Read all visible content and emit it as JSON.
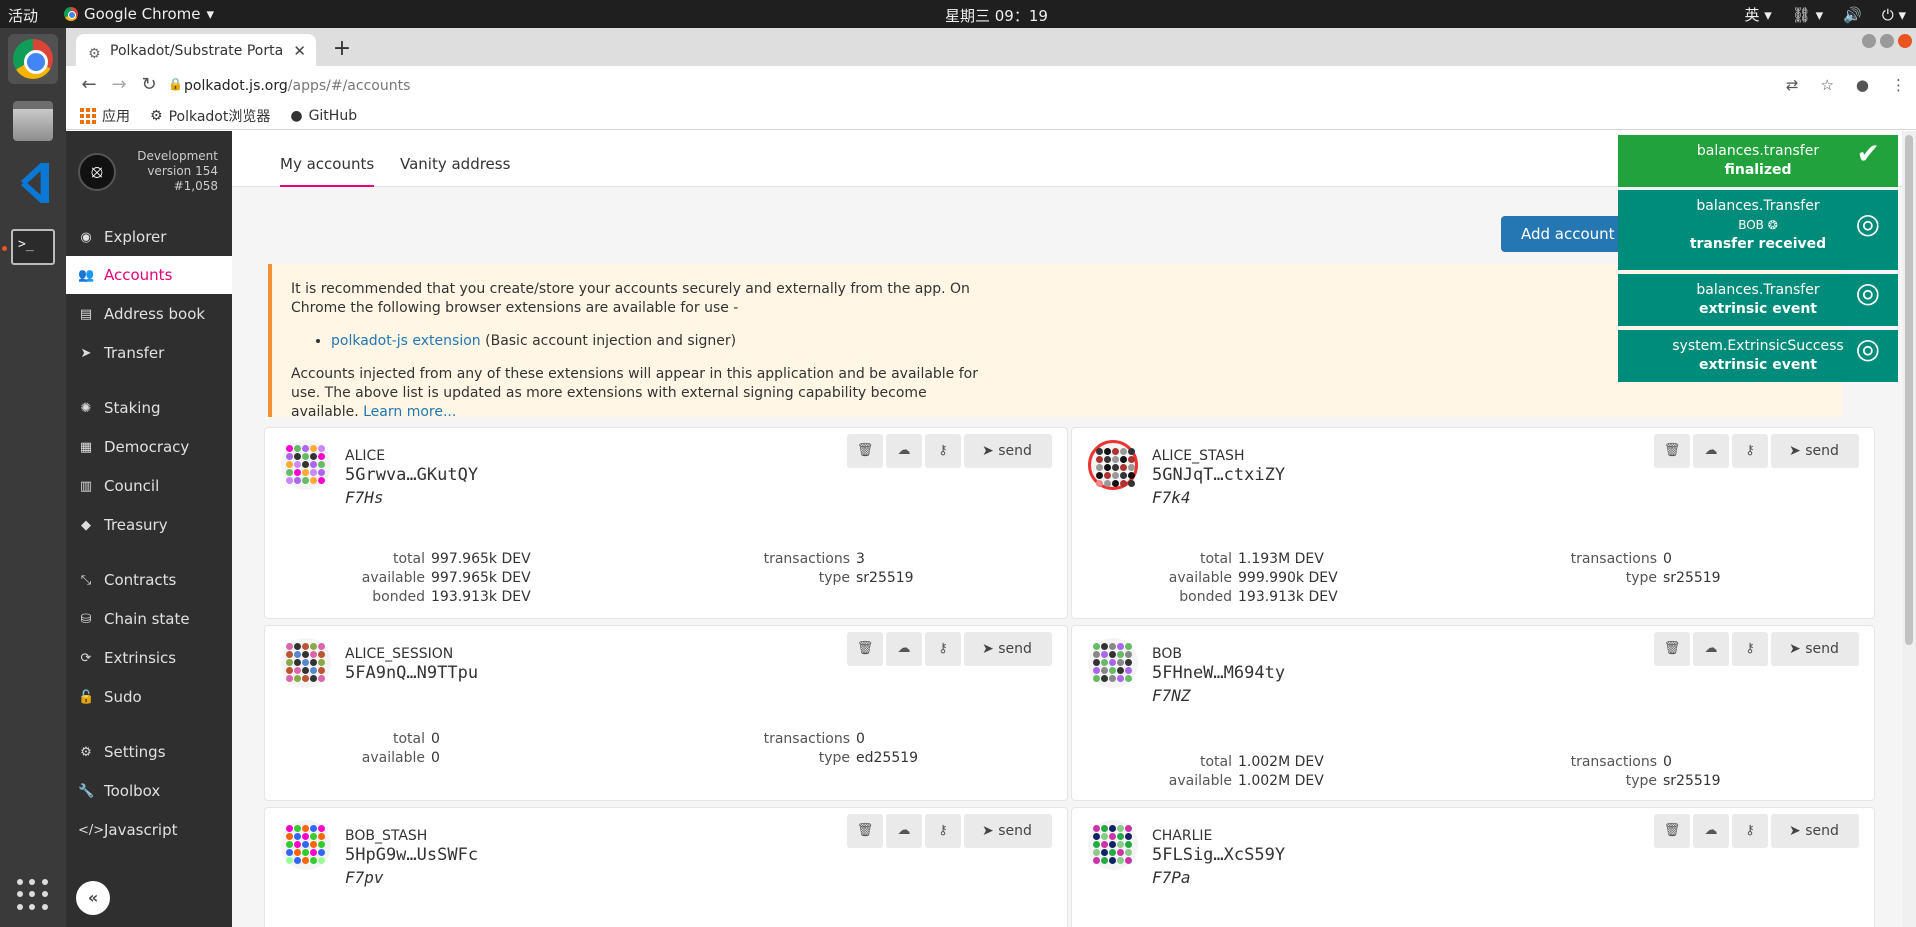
{
  "os": {
    "activities": "活动",
    "app_name": "Google Chrome",
    "clock": "星期三 09：19",
    "ime": "英"
  },
  "browser": {
    "tab_title": "Polkadot/Substrate Porta",
    "url_host": "polkadot.js.org",
    "url_path": "/apps/#/accounts",
    "bookmarks": [
      {
        "label": "应用"
      },
      {
        "label": "Polkadot浏览器"
      },
      {
        "label": "GitHub"
      }
    ]
  },
  "sidebar": {
    "version_lines": [
      "Development",
      "version 154",
      "#1,058"
    ],
    "items": [
      {
        "label": "Explorer",
        "icon": "explorer-icon"
      },
      {
        "label": "Accounts",
        "icon": "users-icon"
      },
      {
        "label": "Address book",
        "icon": "address-book-icon"
      },
      {
        "label": "Transfer",
        "icon": "send-icon"
      },
      {
        "label": "Staking",
        "icon": "certificate-icon"
      },
      {
        "label": "Democracy",
        "icon": "calendar-check-icon"
      },
      {
        "label": "Council",
        "icon": "building-icon"
      },
      {
        "label": "Treasury",
        "icon": "gem-icon"
      },
      {
        "label": "Contracts",
        "icon": "compress-icon"
      },
      {
        "label": "Chain state",
        "icon": "database-icon"
      },
      {
        "label": "Extrinsics",
        "icon": "sync-icon"
      },
      {
        "label": "Sudo",
        "icon": "unlock-icon"
      },
      {
        "label": "Settings",
        "icon": "cogs-icon"
      },
      {
        "label": "Toolbox",
        "icon": "wrench-icon"
      },
      {
        "label": "Javascript",
        "icon": "code-icon"
      }
    ]
  },
  "page": {
    "tabs": [
      {
        "label": "My accounts"
      },
      {
        "label": "Vanity address"
      }
    ],
    "add_account": "Add account",
    "notice": {
      "p1": "It is recommended that you create/store your accounts securely and externally from the app. On Chrome the following browser extensions are available for use -",
      "ext_link": "polkadot-js extension",
      "ext_desc": " (Basic account injection and signer)",
      "p2": "Accounts injected from any of these extensions will appear in this application and be available for use. The above list is updated as more extensions with external signing capability become available.",
      "learn_more": "Learn more..."
    },
    "send_label": "send",
    "labels": {
      "total": "total",
      "available": "available",
      "bonded": "bonded",
      "transactions": "transactions",
      "type": "type"
    },
    "accounts": [
      {
        "name": "ALICE",
        "address": "5Grwva…GKutQY",
        "tag": "F7Hs",
        "total": "997.965k DEV",
        "available": "997.965k DEV",
        "bonded": "193.913k DEV",
        "transactions": "3",
        "type": "sr25519"
      },
      {
        "name": "ALICE_STASH",
        "address": "5GNJqT…ctxiZY",
        "tag": "F7k4",
        "total": "1.193M DEV",
        "available": "999.990k DEV",
        "bonded": "193.913k DEV",
        "transactions": "0",
        "type": "sr25519"
      },
      {
        "name": "ALICE_SESSION",
        "address": "5FA9nQ…N9TTpu",
        "tag": "",
        "total": "0",
        "available": "0",
        "transactions": "0",
        "type": "ed25519"
      },
      {
        "name": "BOB",
        "address": "5FHneW…M694ty",
        "tag": "F7NZ",
        "total": "1.002M DEV",
        "available": "1.002M DEV",
        "transactions": "0",
        "type": "sr25519"
      },
      {
        "name": "BOB_STASH",
        "address": "5HpG9w…UsSWFc",
        "tag": "F7pv"
      },
      {
        "name": "CHARLIE",
        "address": "5FLSig…XcS59Y",
        "tag": "F7Pa"
      }
    ]
  },
  "notifications": [
    {
      "line1": "balances.transfer",
      "line2": "finalized",
      "color": "#21a23c"
    },
    {
      "line1": "balances.Transfer",
      "who": "BOB",
      "line2": "transfer received",
      "color": "#008c7a"
    },
    {
      "line1": "balances.Transfer",
      "line2": "extrinsic event",
      "color": "#008c7a"
    },
    {
      "line1": "system.ExtrinsicSuccess",
      "line2": "extrinsic event",
      "color": "#008c7a"
    }
  ],
  "colors": {
    "accent": "#e6007a",
    "primary": "#2477b3",
    "sidebar": "#2f2f2f"
  }
}
